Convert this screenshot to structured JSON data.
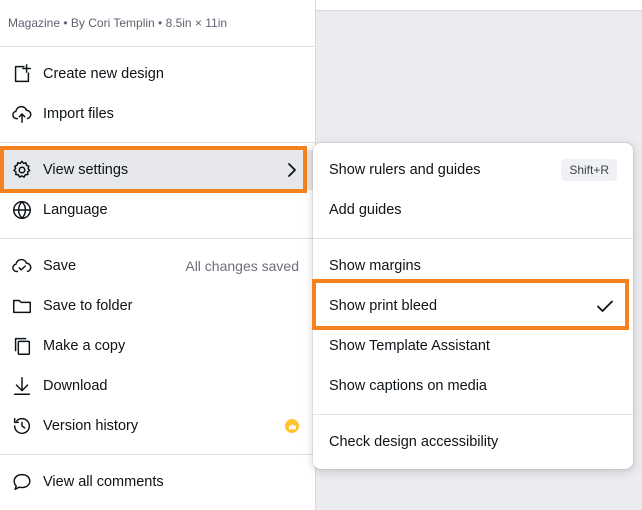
{
  "header": {
    "meta": "Magazine • By Cori Templin • 8.5in × 11in"
  },
  "menu": {
    "create_new_design": "Create new design",
    "import_files": "Import files",
    "view_settings": "View settings",
    "language": "Language",
    "save": "Save",
    "save_status": "All changes saved",
    "save_to_folder": "Save to folder",
    "make_a_copy": "Make a copy",
    "download": "Download",
    "version_history": "Version history",
    "view_all_comments": "View all comments"
  },
  "submenu": {
    "rulers": "Show rulers and guides",
    "rulers_shortcut": "Shift+R",
    "add_guides": "Add guides",
    "margins": "Show margins",
    "print_bleed": "Show print bleed",
    "print_bleed_checked": true,
    "template_assistant": "Show Template Assistant",
    "captions": "Show captions on media",
    "accessibility": "Check design accessibility"
  },
  "colors": {
    "highlight": "#f5811f",
    "crown": "#ffc331",
    "active_bg": "#e5e7eb"
  }
}
